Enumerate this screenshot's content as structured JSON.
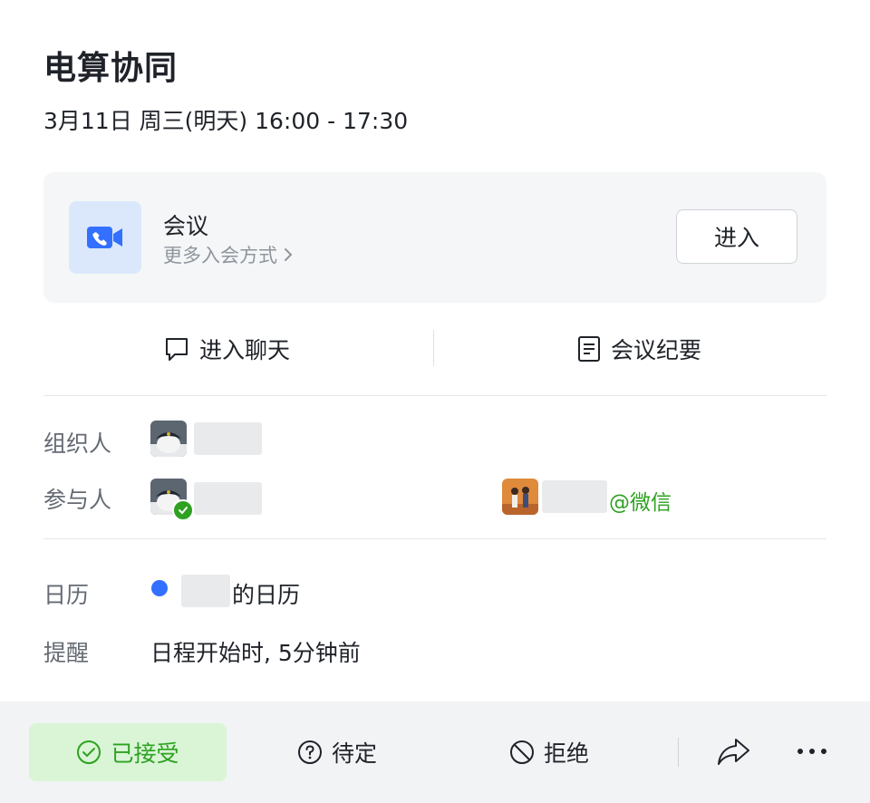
{
  "event": {
    "title": "电算协同",
    "time": "3月11日 周三(明天) 16:00 - 17:30"
  },
  "meeting": {
    "title": "会议",
    "more_join": "更多入会方式",
    "enter_label": "进入",
    "icon": "video-camera-icon"
  },
  "actions": {
    "chat_label": "进入聊天",
    "notes_label": "会议纪要"
  },
  "people": {
    "organizer_label": "组织人",
    "participants_label": "参与人",
    "wechat_suffix": "@微信"
  },
  "calendar": {
    "label": "日历",
    "name_suffix": "的日历",
    "color": "#3370ff"
  },
  "reminder": {
    "label": "提醒",
    "value": "日程开始时, 5分钟前"
  },
  "rsvp": {
    "accepted_label": "已接受",
    "pending_label": "待定",
    "decline_label": "拒绝",
    "accent": "#2ea121"
  }
}
